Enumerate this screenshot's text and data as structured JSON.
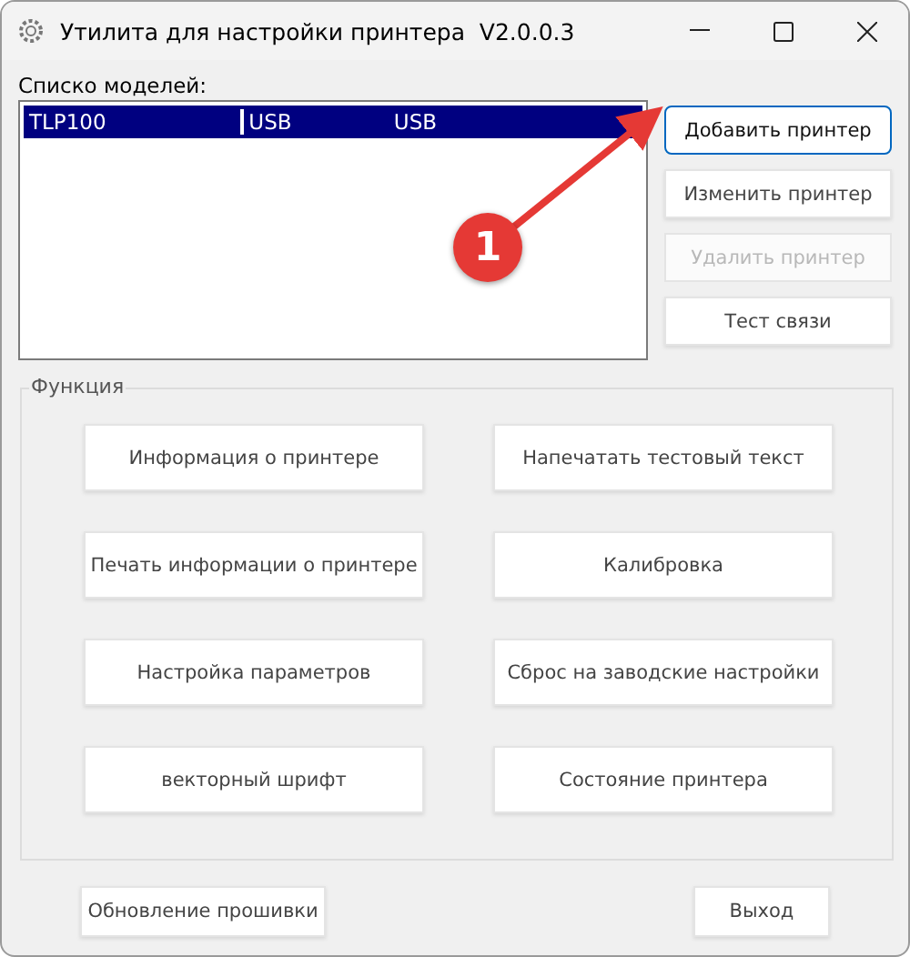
{
  "window": {
    "title": "Утилита для настройки принтера  V2.0.0.3"
  },
  "models": {
    "label": "Списко моделей:",
    "rows": [
      {
        "cells": [
          "TLP100",
          "USB",
          "USB"
        ],
        "selected": true
      }
    ]
  },
  "side_buttons": [
    {
      "label": "Добавить принтер",
      "disabled": false,
      "focused": true
    },
    {
      "label": "Изменить принтер",
      "disabled": false,
      "focused": false
    },
    {
      "label": "Удалить принтер",
      "disabled": true,
      "focused": false
    },
    {
      "label": "Тест связи",
      "disabled": false,
      "focused": false
    }
  ],
  "functions": {
    "title": "Функция",
    "buttons": [
      {
        "label": "Информация о принтере",
        "disabled": false
      },
      {
        "label": "Напечатать тестовый текст",
        "disabled": false
      },
      {
        "label": "Печать информации о принтере",
        "disabled": false
      },
      {
        "label": "Калибровка",
        "disabled": false
      },
      {
        "label": "Настройка параметров",
        "disabled": false
      },
      {
        "label": "Сброс на заводские настройки",
        "disabled": false
      },
      {
        "label": "векторный шрифт",
        "disabled": false
      },
      {
        "label": "Состояние принтера",
        "disabled": false
      }
    ]
  },
  "bottom_buttons": [
    {
      "label": "Обновление прошивки",
      "disabled": false
    },
    {
      "label": "Выход",
      "disabled": false
    }
  ],
  "annotation": {
    "text": "1"
  }
}
